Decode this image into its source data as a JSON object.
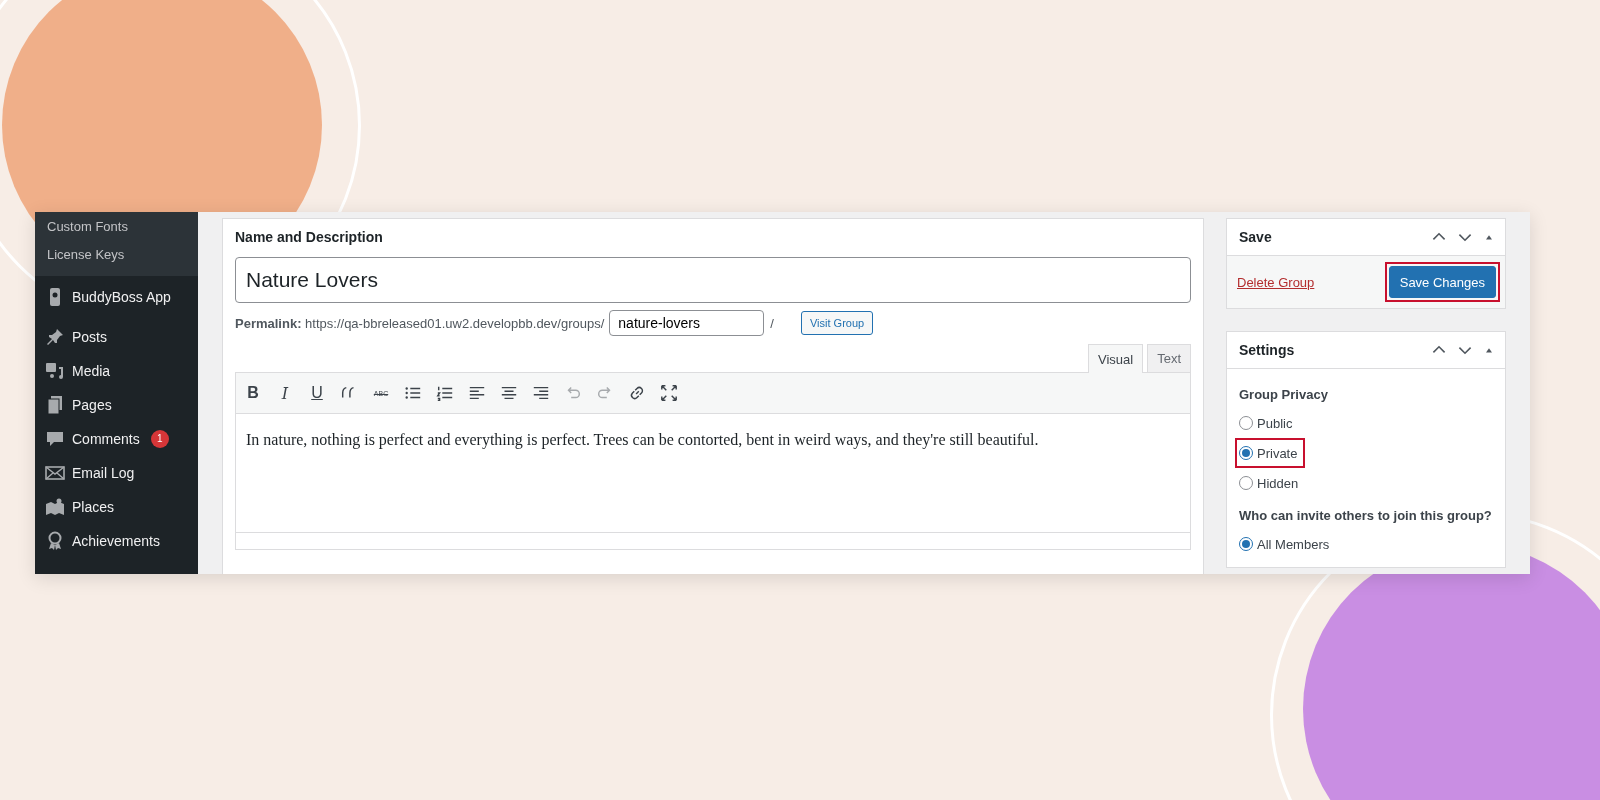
{
  "sidebar": {
    "items": [
      {
        "label": "Custom Fonts",
        "kind": "submenu"
      },
      {
        "label": "License Keys",
        "kind": "submenu"
      },
      {
        "label": "BuddyBoss App",
        "kind": "menu"
      },
      {
        "label": "Posts",
        "kind": "menu"
      },
      {
        "label": "Media",
        "kind": "menu"
      },
      {
        "label": "Pages",
        "kind": "menu"
      },
      {
        "label": "Comments",
        "kind": "menu",
        "badge": "1"
      },
      {
        "label": "Email Log",
        "kind": "menu"
      },
      {
        "label": "Places",
        "kind": "menu"
      },
      {
        "label": "Achievements",
        "kind": "menu"
      }
    ]
  },
  "main": {
    "title": "Name and Description",
    "name_value": "Nature Lovers",
    "permalink": {
      "label": "Permalink:",
      "url": "https://qa-bbreleased01.uw2.developbb.dev/groups/",
      "slug": "nature-lovers",
      "separator": "/",
      "button": "Visit Group"
    },
    "editor_tabs": [
      {
        "label": "Visual",
        "selected": true
      },
      {
        "label": "Text",
        "selected": false
      }
    ],
    "toolbar": [
      {
        "kind": "text",
        "label": "B"
      },
      {
        "kind": "text",
        "label": "I"
      },
      {
        "kind": "text",
        "label": "U"
      },
      {
        "kind": "icon"
      },
      {
        "kind": "text",
        "label": "ABC"
      },
      {
        "kind": "icon"
      },
      {
        "kind": "icon"
      },
      {
        "kind": "icon"
      },
      {
        "kind": "icon"
      },
      {
        "kind": "icon"
      },
      {
        "kind": "icon"
      },
      {
        "kind": "icon"
      },
      {
        "kind": "icon"
      },
      {
        "kind": "icon"
      }
    ],
    "content": "In nature, nothing is perfect and everything is perfect. Trees can be contorted, bent in weird ways, and they're still beautiful."
  },
  "save_box": {
    "title": "Save",
    "delete_link": "Delete Group",
    "save_button": {
      "label": "Save Changes",
      "highlighted": true
    }
  },
  "settings_box": {
    "title": "Settings",
    "privacy": {
      "label": "Group Privacy",
      "options": [
        {
          "label": "Public",
          "selected": false,
          "highlighted": false
        },
        {
          "label": "Private",
          "selected": true,
          "highlighted": true
        },
        {
          "label": "Hidden",
          "selected": false,
          "highlighted": false
        }
      ]
    },
    "invite": {
      "label": "Who can invite others to join this group?",
      "options": [
        {
          "label": "All Members",
          "selected": true,
          "highlighted": false
        }
      ]
    }
  }
}
